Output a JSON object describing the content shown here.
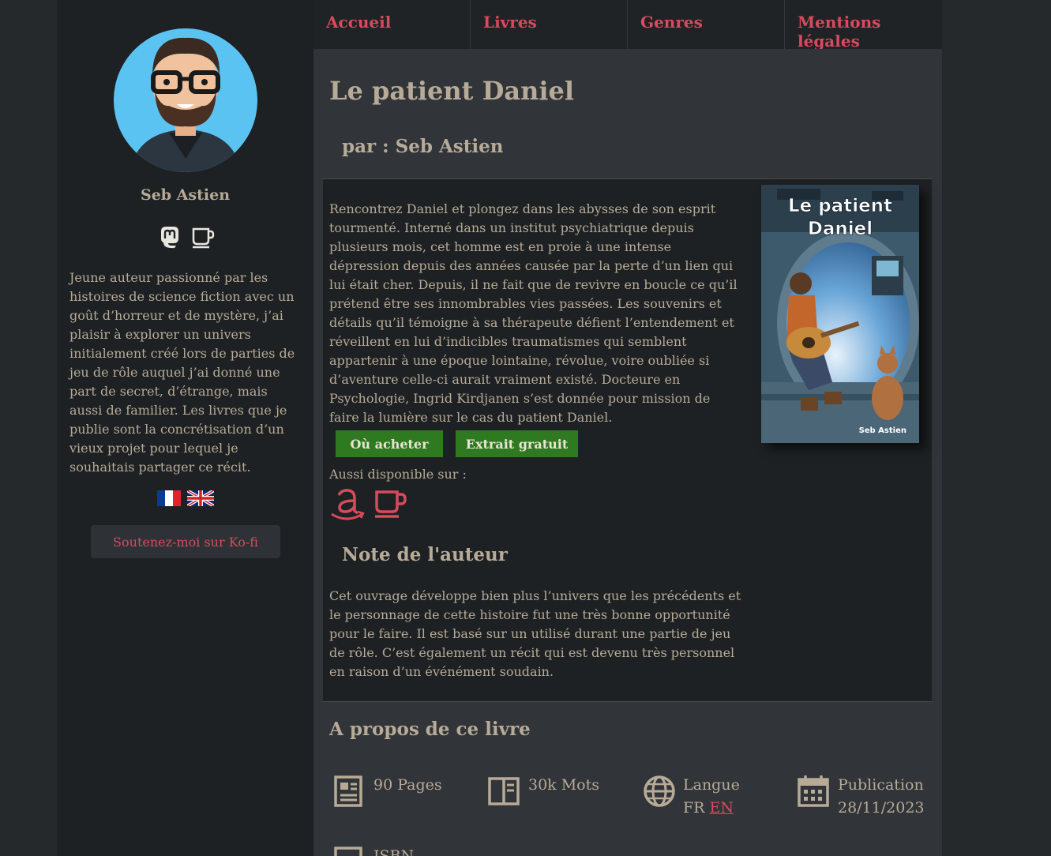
{
  "sidebar": {
    "author_name": "Seb Astien",
    "social_icons": [
      "mastodon-icon",
      "kofi-cup-icon"
    ],
    "bio": "Jeune auteur passionné par les histoires de science fiction avec un goût d’horreur et de mystère, j’ai plaisir à explorer un univers initialement créé lors de parties de jeu de rôle auquel j’ai donné une part de secret, d’étrange, mais aussi de familier. Les livres que je publie sont la concrétisation d’un vieux projet pour lequel je souhaitais partager ce récit.",
    "flags": [
      "flag-fr-icon",
      "flag-uk-icon"
    ],
    "kofi_button": "Soutenez-moi sur Ko-fi"
  },
  "nav": {
    "items": [
      {
        "label": "Accueil"
      },
      {
        "label": "Livres"
      },
      {
        "label": "Genres"
      },
      {
        "label": "Mentions légales"
      }
    ]
  },
  "book": {
    "title": "Le patient Daniel",
    "byline": "par : Seb Astien",
    "description": "Rencontrez Daniel et plongez dans les abysses de son esprit tourmenté. Interné dans un institut psychiatrique depuis plusieurs mois, cet homme est en proie à une intense dépression depuis des années causée par la perte d’un lien qui lui était cher. Depuis, il ne fait que de revivre en boucle ce qu’il prétend être ses innombrables vies passées. Les souvenirs et détails qu’il témoigne à sa thérapeute défient l’entendement et réveillent en lui d’indicibles traumatismes qui semblent appartenir à une époque lointaine, révolue, voire oubliée si d’aventure celle-ci aurait vraiment existé. Docteure en Psychologie, Ingrid Kirdjanen s’est donnée pour mission de faire la lumière sur le cas du patient Daniel.",
    "cover": {
      "title_line1": "Le patient",
      "title_line2": "Daniel",
      "author": "Seb Astien"
    },
    "buy_button": "Où acheter",
    "excerpt_button": "Extrait gratuit",
    "available_label": "Aussi disponible sur :",
    "available_icons": [
      "amazon-icon",
      "kofi-cup-icon"
    ],
    "note_title": "Note de l'auteur",
    "note": "Cet ouvrage développe bien plus l’univers que les précédents et le personnage de cette histoire fut une très bonne opportunité pour le faire. Il est basé sur un utilisé durant une partie de jeu de rôle. C’est également un récit qui est devenu très personnel en raison d’un événément soudain."
  },
  "about": {
    "title": "A propos de ce livre",
    "pages": "90 Pages",
    "words": "30k Mots",
    "language_label": "Langue",
    "language_fr": "FR",
    "language_en": "EN",
    "publication_label": "Publication",
    "publication_date": "28/11/2023",
    "isbn_label": "ISBN"
  },
  "colors": {
    "accent": "#d84a5d",
    "button_green": "#2f7a21",
    "text": "#b7ab98",
    "panel_dark": "#1e2123",
    "main_bg": "#313438"
  }
}
